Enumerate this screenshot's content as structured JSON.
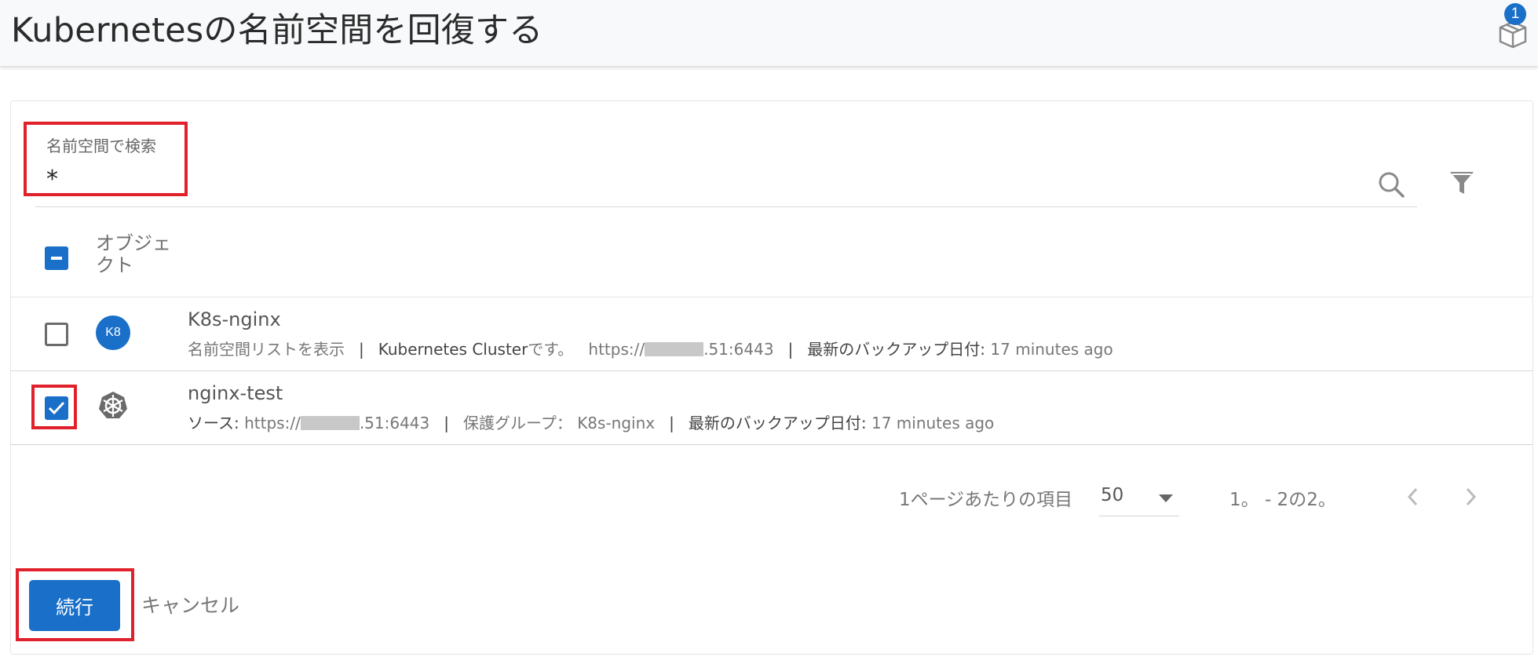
{
  "header": {
    "title": "Kubernetesの名前空間を回復する",
    "notification_count": "1"
  },
  "search": {
    "label": "名前空間で検索",
    "value": "*"
  },
  "table": {
    "column_header": "オブジェクト",
    "rows": [
      {
        "title": "K8s-nginx",
        "avatar_text": "K8",
        "checked": false,
        "meta": {
          "part1": "名前空間リストを表示",
          "cluster_label": "Kubernetes Cluster",
          "cluster_suffix": "です。",
          "url_prefix": "https://",
          "url_suffix": ".51:6443",
          "backup_label": "最新のバックアップ日付:",
          "backup_value": "17 minutes ago"
        }
      },
      {
        "title": "nginx-test",
        "checked": true,
        "meta": {
          "source_label": "ソース:",
          "url_prefix": "https://",
          "url_suffix": ".51:6443",
          "group_label": "保護グループ：",
          "group_value": "K8s-nginx",
          "backup_label": "最新のバックアップ日付:",
          "backup_value": "17 minutes ago"
        }
      }
    ]
  },
  "pagination": {
    "items_per_page_label": "1ページあたりの項目",
    "items_per_page_value": "50",
    "range_text": "1。 - 2の2。"
  },
  "actions": {
    "continue_label": "続行",
    "cancel_label": "キャンセル"
  },
  "colors": {
    "primary": "#1a6fc9",
    "highlight": "#e0202a"
  }
}
